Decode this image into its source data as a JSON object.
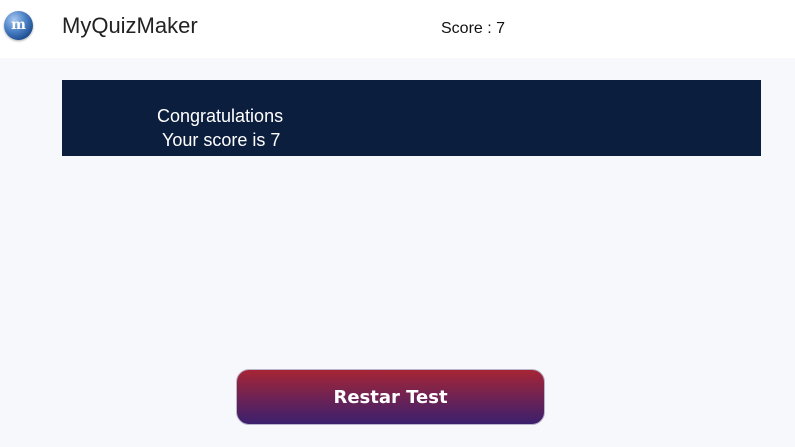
{
  "header": {
    "logo_icon": "quiz-logo-icon",
    "logo_letter": "m",
    "app_title": "MyQuizMaker",
    "score_text": "Score : 7"
  },
  "result": {
    "congrats": "Congratulations",
    "score_line": "Your score is 7"
  },
  "actions": {
    "restart_label": "Restar Test"
  },
  "colors": {
    "page_background": "#f7f8fc",
    "panel_background": "#0c1e3d",
    "button_gradient_top": "#a62535",
    "button_gradient_bottom": "#3b1f6d"
  }
}
